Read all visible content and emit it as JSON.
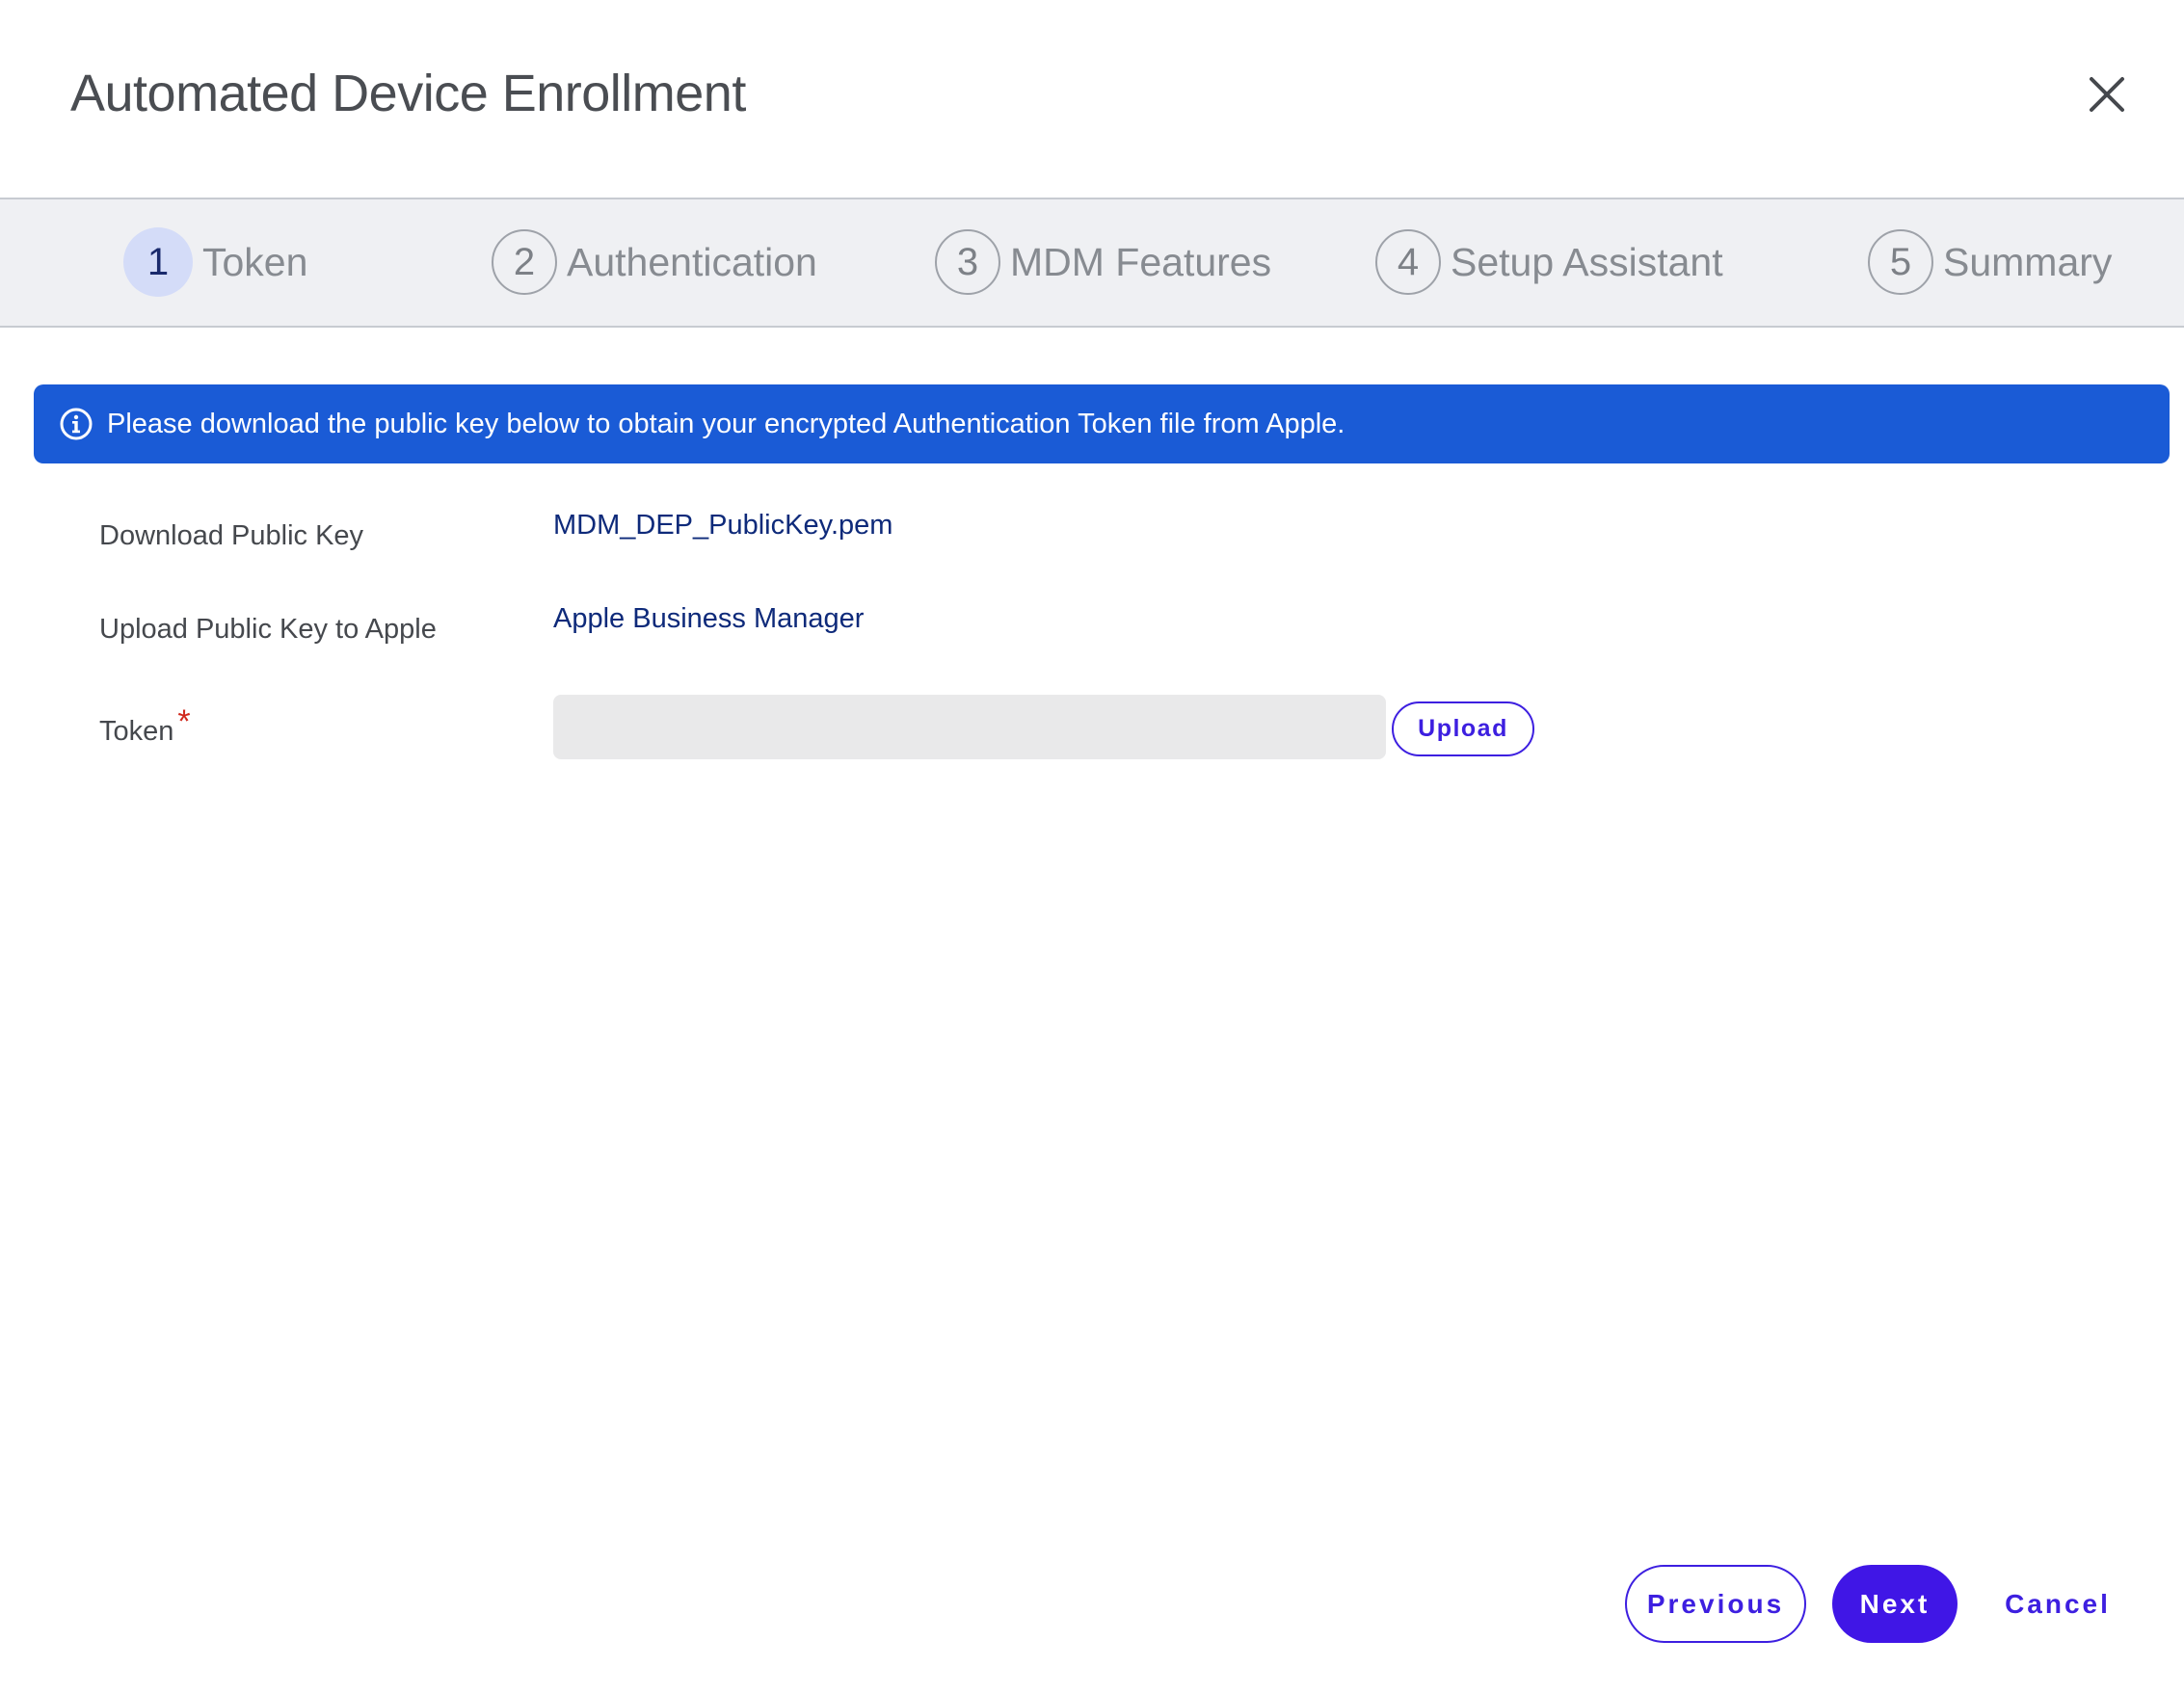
{
  "dialog": {
    "title": "Automated Device Enrollment"
  },
  "stepper": {
    "steps": [
      {
        "number": "1",
        "label": "Token",
        "active": true
      },
      {
        "number": "2",
        "label": "Authentication",
        "active": false
      },
      {
        "number": "3",
        "label": "MDM Features",
        "active": false
      },
      {
        "number": "4",
        "label": "Setup Assistant",
        "active": false
      },
      {
        "number": "5",
        "label": "Summary",
        "active": false
      }
    ]
  },
  "banner": {
    "icon": "info-icon",
    "text": "Please download the public key below to obtain your encrypted Authentication Token file from Apple."
  },
  "form": {
    "download_key_label": "Download Public Key",
    "download_key_link": "MDM_DEP_PublicKey.pem",
    "upload_key_label": "Upload Public Key to Apple",
    "upload_key_link": "Apple Business Manager",
    "token_label": "Token",
    "token_required_mark": "*",
    "token_value": "",
    "upload_button": "Upload"
  },
  "footer": {
    "previous_label": "Previous",
    "next_label": "Next",
    "cancel_label": "Cancel"
  },
  "colors": {
    "accent": "#3d1fe0",
    "banner": "#1a5bd6",
    "link": "#0e2a7a",
    "required": "#d0281c"
  }
}
